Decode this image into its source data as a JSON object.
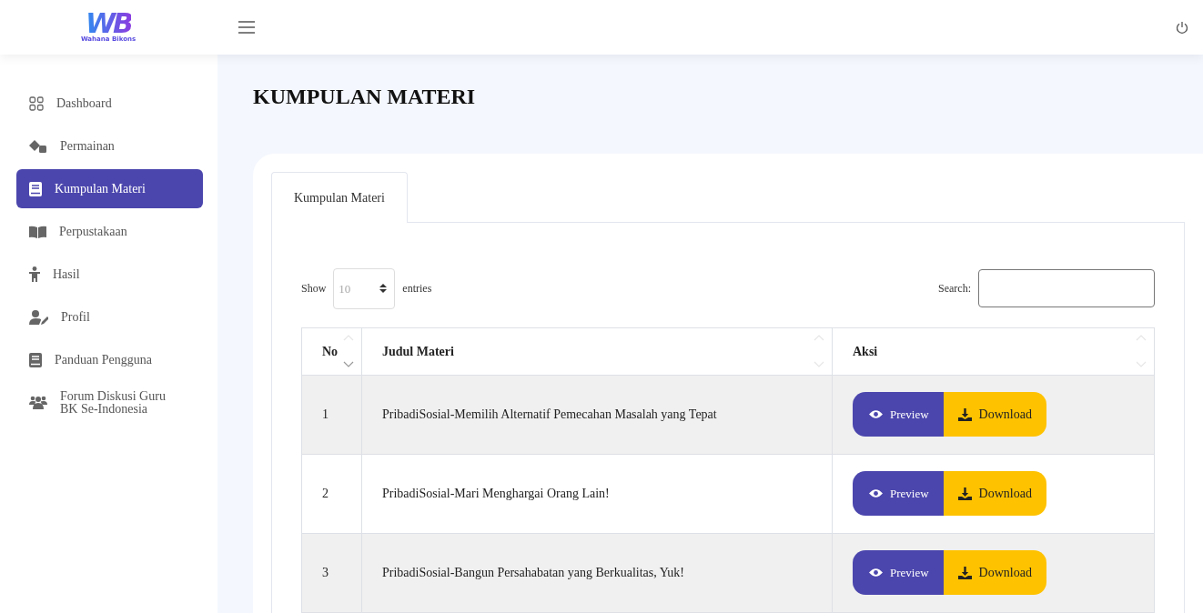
{
  "logo": {
    "mark": "WB",
    "name": "Wahana Bikons"
  },
  "sidebar": {
    "items": [
      {
        "label": "Dashboard",
        "kind": "grid",
        "selected": false
      },
      {
        "label": "Permainan",
        "kind": "dice",
        "selected": false
      },
      {
        "label": "Kumpulan Materi",
        "kind": "book",
        "selected": true
      },
      {
        "label": "Perpustakaan",
        "kind": "openbook",
        "selected": false
      },
      {
        "label": "Hasil",
        "kind": "child",
        "selected": false
      },
      {
        "label": "Profil",
        "kind": "useredit",
        "selected": false
      },
      {
        "label": "Panduan Pengguna",
        "kind": "book",
        "selected": false
      },
      {
        "label": "Forum Diskusi Guru BK Se-Indonesia",
        "kind": "users",
        "selected": false
      }
    ]
  },
  "page_title": "KUMPULAN MATERI",
  "tabs": [
    {
      "label": "Kumpulan Materi",
      "selected": true
    }
  ],
  "length": {
    "show": "Show",
    "value": "10",
    "entries": "entries"
  },
  "search": {
    "label": "Search:"
  },
  "table": {
    "columns": [
      "No",
      "Judul Materi",
      "Aksi"
    ],
    "rows": [
      {
        "no": "1",
        "title": "PribadiSosial-Memilih Alternatif Pemecahan Masalah yang Tepat",
        "preview": "Preview",
        "download": "Download"
      },
      {
        "no": "2",
        "title": "PribadiSosial-Mari Menghargai Orang Lain!",
        "preview": "Preview",
        "download": "Download"
      },
      {
        "no": "3",
        "title": "PribadiSosial-Bangun Persahabatan yang Berkualitas, Yuk!",
        "preview": "Preview",
        "download": "Download"
      }
    ]
  }
}
